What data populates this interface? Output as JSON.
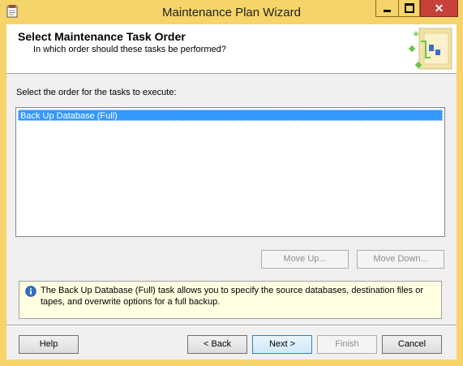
{
  "window": {
    "title": "Maintenance Plan Wizard",
    "frame_color": "#f5d46a",
    "close_color": "#c7403a"
  },
  "header": {
    "title": "Select Maintenance Task Order",
    "subtitle": "In which order should these tasks be performed?"
  },
  "main": {
    "prompt": "Select the order for the tasks to execute:",
    "tasks": [
      {
        "label": "Back Up Database (Full)",
        "selected": true
      }
    ],
    "move_up_label": "Move Up...",
    "move_down_label": "Move Down..."
  },
  "info": {
    "icon": "info-icon",
    "text": "The Back Up Database (Full) task allows you to specify the source databases, destination files or tapes, and overwrite options for a full backup."
  },
  "footer": {
    "help_label": "Help",
    "back_label": "< Back",
    "next_label": "Next >",
    "finish_label": "Finish",
    "cancel_label": "Cancel"
  },
  "colors": {
    "selection": "#3399ff",
    "info_background": "#ffffe1"
  }
}
